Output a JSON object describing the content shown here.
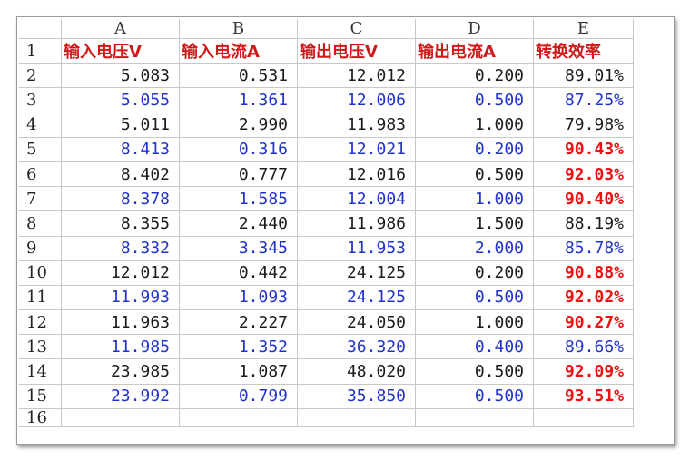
{
  "spreadsheet": {
    "column_headers": [
      "A",
      "B",
      "C",
      "D",
      "E"
    ],
    "row_numbers": [
      "1",
      "2",
      "3",
      "4",
      "5",
      "6",
      "7",
      "8",
      "9",
      "10",
      "11",
      "12",
      "13",
      "14",
      "15",
      "16"
    ],
    "header_row": [
      "输入电压V",
      "输入电流A",
      "输出电压V",
      "输出电流A",
      "转换效率"
    ],
    "rows": [
      {
        "cells": [
          "5.083",
          "0.531",
          "12.012",
          "0.200",
          "89.01%"
        ],
        "style": "black",
        "efficiency_style": "black"
      },
      {
        "cells": [
          "5.055",
          "1.361",
          "12.006",
          "0.500",
          "87.25%"
        ],
        "style": "blue",
        "efficiency_style": "blue"
      },
      {
        "cells": [
          "5.011",
          "2.990",
          "11.983",
          "1.000",
          "79.98%"
        ],
        "style": "black",
        "efficiency_style": "black"
      },
      {
        "cells": [
          "8.413",
          "0.316",
          "12.021",
          "0.200",
          "90.43%"
        ],
        "style": "blue",
        "efficiency_style": "red"
      },
      {
        "cells": [
          "8.402",
          "0.777",
          "12.016",
          "0.500",
          "92.03%"
        ],
        "style": "black",
        "efficiency_style": "red"
      },
      {
        "cells": [
          "8.378",
          "1.585",
          "12.004",
          "1.000",
          "90.40%"
        ],
        "style": "blue",
        "efficiency_style": "red"
      },
      {
        "cells": [
          "8.355",
          "2.440",
          "11.986",
          "1.500",
          "88.19%"
        ],
        "style": "black",
        "efficiency_style": "black"
      },
      {
        "cells": [
          "8.332",
          "3.345",
          "11.953",
          "2.000",
          "85.78%"
        ],
        "style": "blue",
        "efficiency_style": "blue"
      },
      {
        "cells": [
          "12.012",
          "0.442",
          "24.125",
          "0.200",
          "90.88%"
        ],
        "style": "black",
        "efficiency_style": "red"
      },
      {
        "cells": [
          "11.993",
          "1.093",
          "24.125",
          "0.500",
          "92.02%"
        ],
        "style": "blue",
        "efficiency_style": "red"
      },
      {
        "cells": [
          "11.963",
          "2.227",
          "24.050",
          "1.000",
          "90.27%"
        ],
        "style": "black",
        "efficiency_style": "red"
      },
      {
        "cells": [
          "11.985",
          "1.352",
          "36.320",
          "0.400",
          "89.66%"
        ],
        "style": "blue",
        "efficiency_style": "blue"
      },
      {
        "cells": [
          "23.985",
          "1.087",
          "48.020",
          "0.500",
          "92.09%"
        ],
        "style": "black",
        "efficiency_style": "red"
      },
      {
        "cells": [
          "23.992",
          "0.799",
          "35.850",
          "0.500",
          "93.51%"
        ],
        "style": "blue",
        "efficiency_style": "red"
      }
    ],
    "colors": {
      "header_text": "#d01818",
      "black_text": "#1c1c1c",
      "blue_text": "#2233cc",
      "highlight_red": "#ee1111",
      "gridline": "#c8c8c8"
    }
  }
}
